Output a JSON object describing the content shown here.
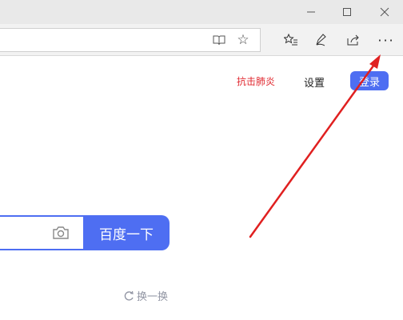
{
  "browser": {
    "window_controls": {
      "minimize_icon": "minimize-icon",
      "maximize_icon": "maximize-icon",
      "close_icon": "close-icon"
    },
    "toolbar": {
      "more_label": "···"
    }
  },
  "page": {
    "top_links": {
      "fight_pneumonia": "抗击肺炎",
      "settings": "设置",
      "login": "登录"
    },
    "search": {
      "button_label": "百度一下",
      "input_value": ""
    },
    "refresh_label": "换一换"
  },
  "colors": {
    "accent": "#4e6ef2",
    "alert_red": "#e0272e",
    "annotation_arrow": "#e02020"
  }
}
